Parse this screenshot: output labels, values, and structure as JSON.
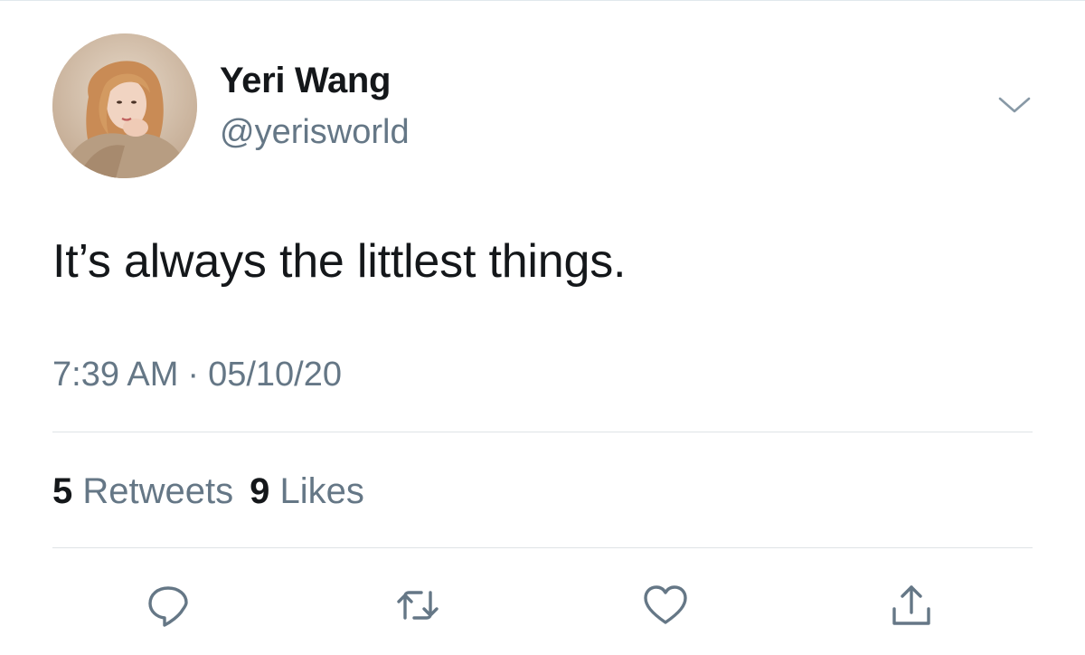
{
  "tweet": {
    "author": {
      "display_name": "Yeri Wang",
      "handle": "@yerisworld"
    },
    "text": "It’s always the littlest things.",
    "time": "7:39 AM",
    "separator": "·",
    "date": "05/10/20",
    "stats": {
      "retweets_count": "5",
      "retweets_label": "Retweets",
      "likes_count": "9",
      "likes_label": "Likes"
    }
  },
  "icons": {
    "caret": "chevron-down-icon",
    "reply": "reply-icon",
    "retweet": "retweet-icon",
    "like": "heart-icon",
    "share": "share-icon"
  },
  "colors": {
    "text_primary": "#14171a",
    "text_secondary": "#657786",
    "icon": "#657786",
    "divider": "#dfe3e6"
  }
}
